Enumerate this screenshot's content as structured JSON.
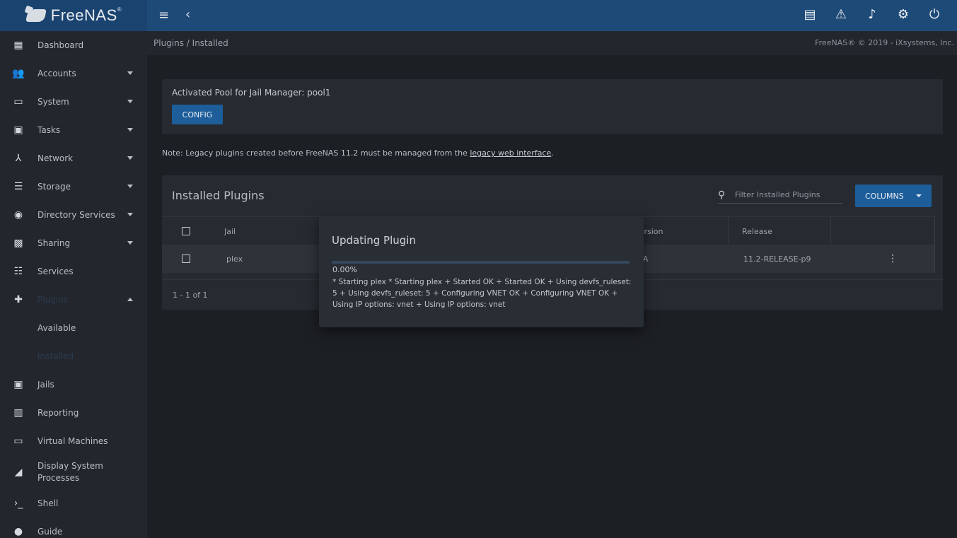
{
  "header": {
    "brand": "FreeNAS",
    "brand_mark": "®",
    "menu_icon": "hamburger-icon",
    "collapse_icon": "chevron-left-icon",
    "actions": [
      {
        "name": "clipboard-icon",
        "glyph": "📋"
      },
      {
        "name": "directory-icon",
        "glyph": "⚠"
      },
      {
        "name": "bell-icon",
        "glyph": "🔔"
      },
      {
        "name": "gear-icon",
        "glyph": "⚙"
      },
      {
        "name": "power-icon",
        "glyph": "⏻"
      }
    ]
  },
  "subbar": {
    "breadcrumb": "Plugins /  Installed",
    "copyright": "FreeNAS® © 2019 - iXsystems, Inc."
  },
  "sidebar": {
    "items": [
      {
        "label": "Dashboard",
        "icon": "dashboard-icon"
      },
      {
        "label": "Accounts",
        "icon": "accounts-icon",
        "expandable": true
      },
      {
        "label": "System",
        "icon": "system-icon",
        "expandable": true
      },
      {
        "label": "Tasks",
        "icon": "calendar-icon",
        "expandable": true
      },
      {
        "label": "Network",
        "icon": "network-icon",
        "expandable": true
      },
      {
        "label": "Storage",
        "icon": "storage-icon",
        "expandable": true
      },
      {
        "label": "Directory Services",
        "icon": "directory-icon",
        "expandable": true
      },
      {
        "label": "Sharing",
        "icon": "sharing-icon",
        "expandable": true
      },
      {
        "label": "Services",
        "icon": "services-icon"
      },
      {
        "label": "Plugins",
        "icon": "puzzle-icon",
        "expanded": true
      },
      {
        "label": "Jails",
        "icon": "jail-icon"
      },
      {
        "label": "Reporting",
        "icon": "reporting-icon"
      },
      {
        "label": "Virtual Machines",
        "icon": "laptop-icon"
      },
      {
        "label": "Display System Processes",
        "icon": "processes-icon"
      },
      {
        "label": "Shell",
        "icon": "shell-icon"
      },
      {
        "label": "Guide",
        "icon": "info-icon"
      }
    ],
    "plugins_sub": [
      "Available",
      "Installed"
    ]
  },
  "pool": {
    "text": "Activated Pool for Jail Manager: pool1",
    "config_label": "CONFIG"
  },
  "note": {
    "prefix": "Note: Legacy plugins created before FreeNAS 11.2 must be managed from the ",
    "link": "legacy web interface",
    "suffix": "."
  },
  "plugins": {
    "title": "Installed Plugins",
    "filter_placeholder": "Filter Installed Plugins",
    "columns_label": "COLUMNS",
    "headers": [
      "Jail",
      "Version",
      "Release"
    ],
    "rows": [
      {
        "jail": "plex",
        "version": "N/A",
        "release": "11.2-RELEASE-p9"
      }
    ],
    "pager": "1 - 1 of 1"
  },
  "dialog": {
    "title": "Updating Plugin",
    "progress_value": 0.0,
    "progress_text": "0.00%",
    "log": "* Starting plex * Starting plex + Started OK + Started OK + Using devfs_ruleset: 5 + Using devfs_ruleset: 5 + Configuring VNET OK + Configuring VNET OK + Using IP options: vnet + Using IP options: vnet"
  },
  "colors": {
    "topbar": "#1e4a78",
    "accent": "#1d5d99",
    "background": "#1c1f24"
  }
}
